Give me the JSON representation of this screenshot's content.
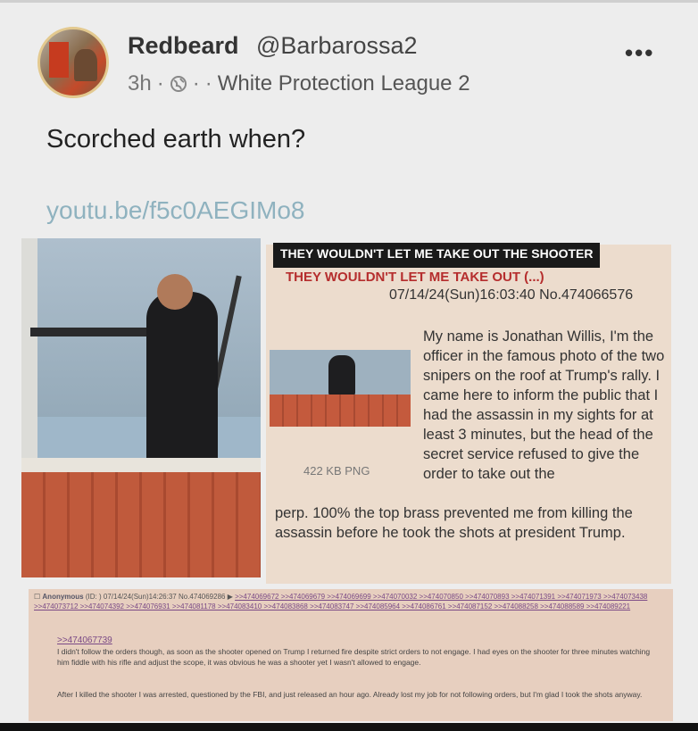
{
  "post": {
    "display_name": "Redbeard",
    "handle": "@Barbarossa2",
    "time": "3h",
    "separator_1": "·",
    "separator_2": "·",
    "separator_3": "·",
    "group": "White Protection League 2",
    "more": "•••",
    "text": "Scorched earth when?",
    "link": "youtu.be/f5c0AEGIMo8"
  },
  "screenshot_panel": {
    "overlay_title": "THEY WOULDN'T LET ME TAKE OUT THE SHOOTER",
    "thread_title": "THEY WOULDN'T LET ME TAKE OUT (...)",
    "thread_meta": "07/14/24(Sun)16:03:40 No.474066576",
    "file_size": "422 KB PNG",
    "body_right": "My name is Jonathan Willis, I'm the officer in the famous photo of the two snipers on the roof at Trump's rally. I came here to inform the public that I had the assassin in my sights for at least 3 minutes, but the head of the secret service refused to give the order to take out the",
    "body_full": "perp. 100% the top brass prevented me from killing the assassin before he took the shots at president Trump."
  },
  "reply_panel": {
    "anon": "Anonymous",
    "id_label": "(ID:",
    "id_close": ")",
    "meta": "07/14/24(Sun)14:26:37 No.474069286 ▶",
    "refs": ">>474069672 >>474069679 >>474069699 >>474070032 >>474070850 >>474070893 >>474071391 >>474071973 >>474073438 >>474073712 >>474074392 >>474076931 >>474081178 >>474083410 >>474083868 >>474083747 >>474085964 >>474086761 >>474087152 >>474088258 >>474088589 >>474089221",
    "quote": ">>474067739",
    "body_1": "I didn't follow the orders though, as soon as the shooter opened on Trump I returned fire despite strict orders to not engage. I had eyes on the shooter for three minutes watching him fiddle with his rifle and adjust the scope, it was obvious he was a shooter yet I wasn't allowed to engage.",
    "body_2": "After I killed the shooter I was arrested, questioned by the FBI, and just released an hour ago. Already lost my job for not following orders, but I'm glad I took the shots anyway."
  },
  "colors": {
    "link": "#8fb2bf",
    "thread_title": "#b52d2d",
    "panel_bg": "#ecdccd",
    "reply_bg": "#e7cfbf"
  }
}
